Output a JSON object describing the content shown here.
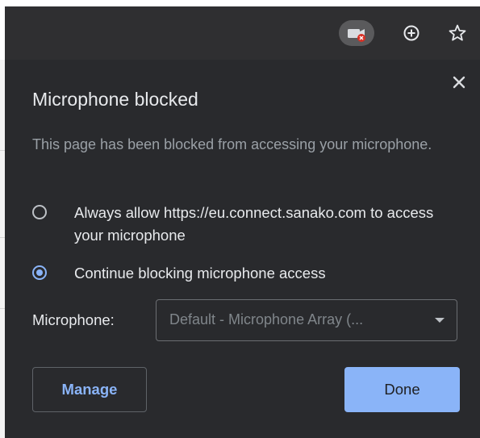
{
  "toolbar": {
    "icons": [
      "camera-blocked-icon",
      "add-circle-icon",
      "star-icon"
    ]
  },
  "popup": {
    "title": "Microphone blocked",
    "description": "This page has been blocked from accessing your microphone.",
    "options": [
      {
        "label": "Always allow https://eu.connect.sanako.com to access your microphone",
        "checked": false
      },
      {
        "label": "Continue blocking microphone access",
        "checked": true
      }
    ],
    "microphone_label": "Microphone:",
    "microphone_selected": "Default - Microphone Array (...",
    "manage_label": "Manage",
    "done_label": "Done"
  },
  "colors": {
    "popup_bg": "#292a2d",
    "accent": "#8ab4f8",
    "blocked_badge": "#d93025"
  }
}
